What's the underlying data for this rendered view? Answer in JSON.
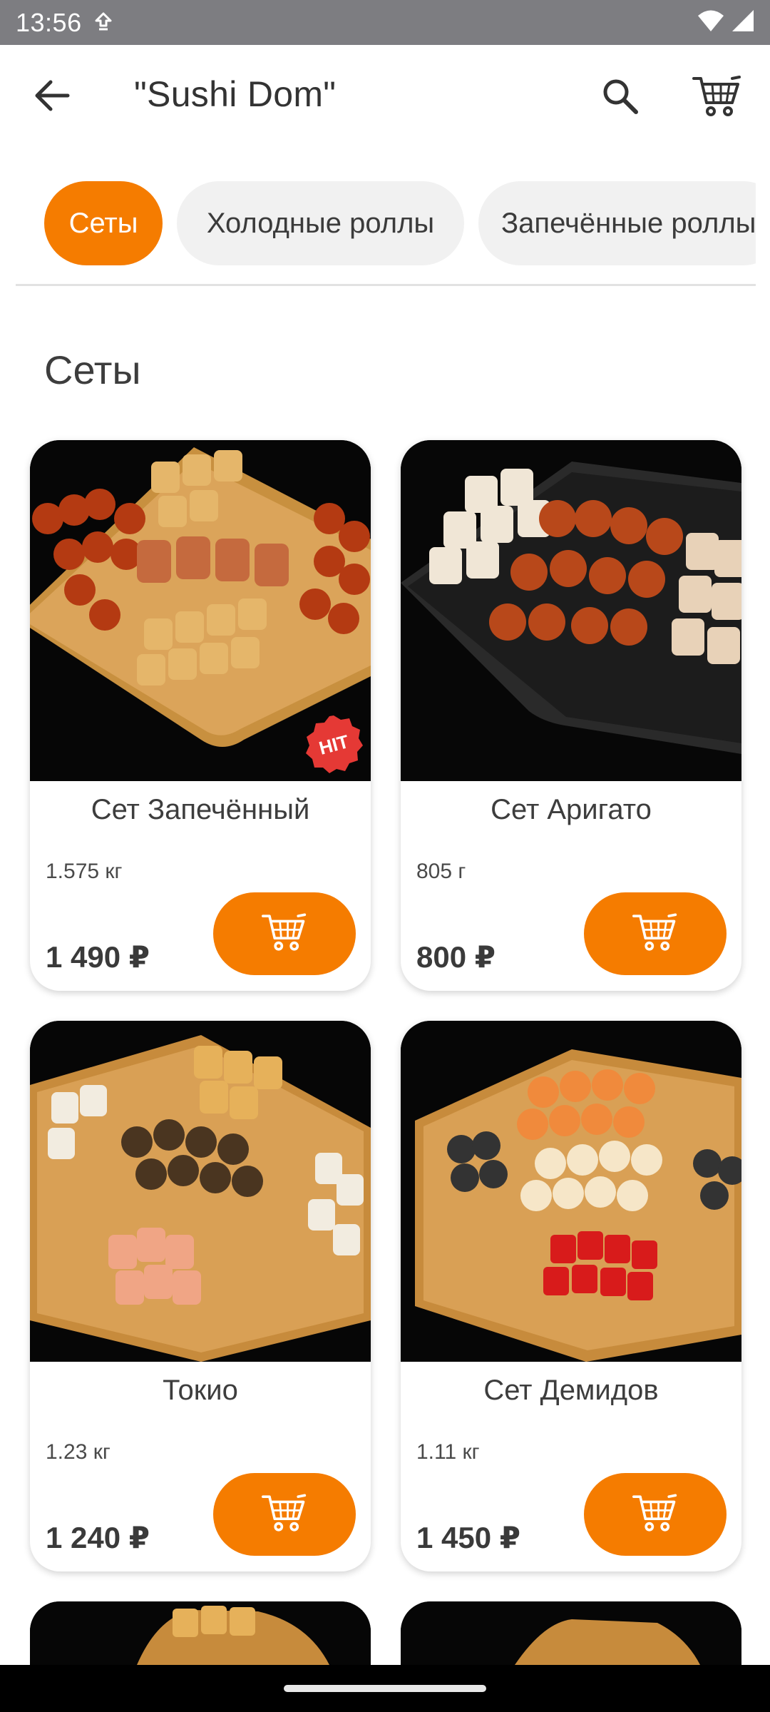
{
  "status_bar": {
    "time": "13:56",
    "icons": [
      "data-saver-icon",
      "wifi-icon",
      "signal-icon"
    ]
  },
  "app_bar": {
    "title": "\"Sushi Dom\"",
    "back_icon": "arrow-left-icon",
    "search_icon": "search-icon",
    "cart_icon": "shopping-cart-icon"
  },
  "categories": [
    {
      "label": "Сеты",
      "active": true
    },
    {
      "label": "Холодные роллы",
      "active": false
    },
    {
      "label": "Запечённые роллы",
      "active": false
    }
  ],
  "section": {
    "title": "Сеты"
  },
  "products": [
    {
      "name": "Сет Запечённый",
      "weight": "1.575 кг",
      "price": "1 490 ₽",
      "badge": "HIT"
    },
    {
      "name": "Сет Аригато",
      "weight": "805 г",
      "price": "800 ₽"
    },
    {
      "name": "Токио",
      "weight": "1.23 кг",
      "price": "1 240 ₽"
    },
    {
      "name": "Сет Демидов",
      "weight": "1.11 кг",
      "price": "1 450 ₽"
    }
  ],
  "colors": {
    "accent": "#f57c00",
    "badge": "#e53935",
    "chip_bg": "#f1f1f1",
    "status_bar": "#7d7d81"
  }
}
